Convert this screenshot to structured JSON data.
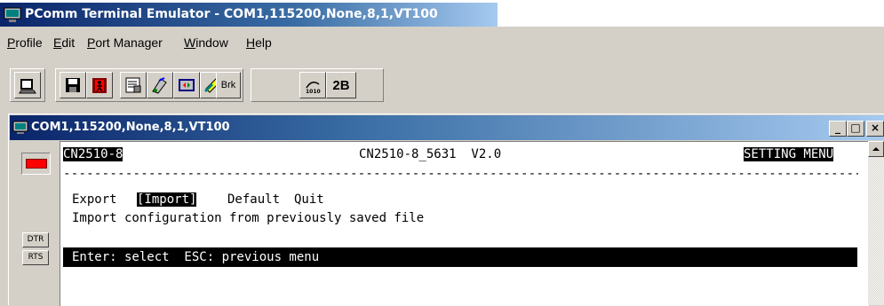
{
  "app": {
    "title": "PComm Terminal Emulator - COM1,115200,None,8,1,VT100",
    "icon": "pcomm-app-icon"
  },
  "menu": [
    {
      "label": "Profile"
    },
    {
      "label": "Edit"
    },
    {
      "label": "Port Manager"
    },
    {
      "label": "Window"
    },
    {
      "label": "Help"
    }
  ],
  "toolbar": {
    "buttons": [
      {
        "name": "open-profile-icon"
      },
      {
        "name": "save-icon"
      },
      {
        "name": "exit-icon"
      },
      {
        "name": "properties-icon"
      },
      {
        "name": "transfer-icon"
      },
      {
        "name": "capture-icon"
      },
      {
        "name": "script-icon"
      },
      {
        "name": "brk-label",
        "label": "Brk"
      },
      {
        "name": "connect-icon"
      },
      {
        "name": "2b-label",
        "label": "2B"
      }
    ]
  },
  "child": {
    "title": "COM1,115200,None,8,1,VT100",
    "minimize": "_",
    "restore": "□",
    "close": "×"
  },
  "signals": {
    "dtr": "DTR",
    "rts": "RTS",
    "led_color": "#ff0000"
  },
  "terminal": {
    "device": "CN2510-8",
    "model_version": "CN2510-8_5631  V2.0",
    "mode": "SETTING MENU",
    "divider": "--------------------------------------------------------------------------------------------------------------------------------------",
    "menu_export": "Export",
    "menu_import": "[Import]",
    "menu_default": "Default",
    "menu_quit": "Quit",
    "description": "Import configuration from previously saved file",
    "status": "Enter: select  ESC: previous menu"
  }
}
